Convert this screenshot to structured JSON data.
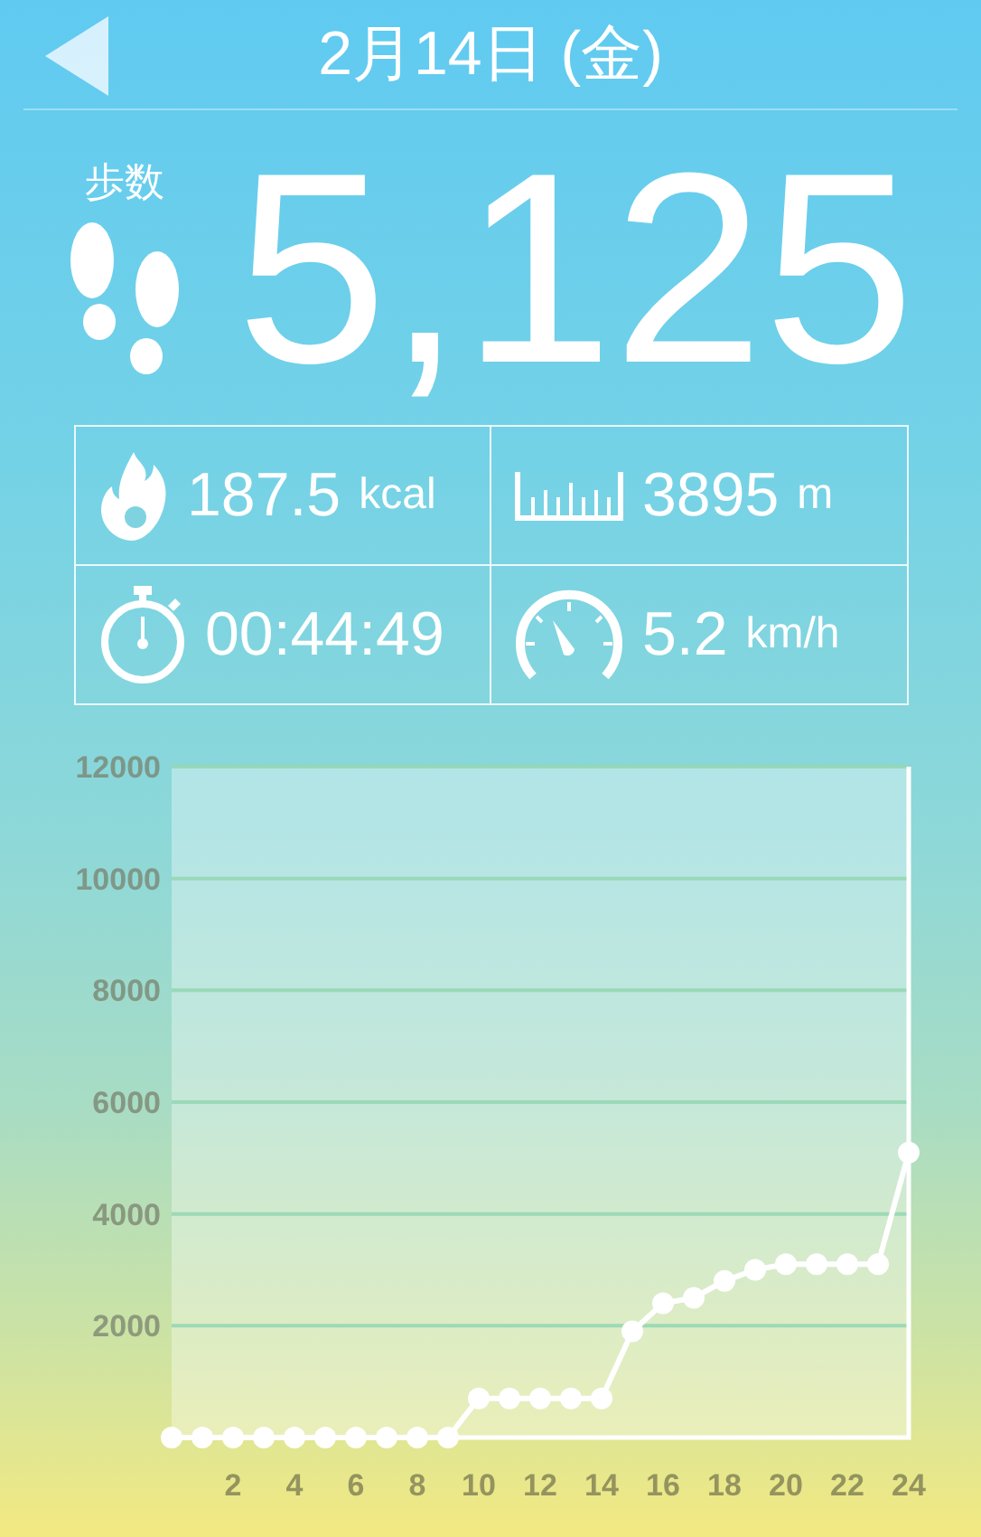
{
  "header": {
    "title": "2月14日 (金)"
  },
  "steps": {
    "label": "歩数",
    "value": "5,125"
  },
  "stats": [
    {
      "kind": "calories",
      "value": "187.5",
      "unit": "kcal"
    },
    {
      "kind": "distance",
      "value": "3895",
      "unit": "m"
    },
    {
      "kind": "time",
      "value": "00:44:49"
    },
    {
      "kind": "speed",
      "value": "5.2",
      "unit": "km/h"
    }
  ],
  "chart_data": {
    "type": "line",
    "grid": true,
    "x": [
      0,
      1,
      2,
      3,
      4,
      5,
      6,
      7,
      8,
      9,
      10,
      11,
      12,
      13,
      14,
      15,
      16,
      17,
      18,
      19,
      20,
      21,
      22,
      23,
      24
    ],
    "series": [
      {
        "color": "#ffffff",
        "marker": true,
        "values": [
          0,
          0,
          0,
          0,
          0,
          0,
          0,
          0,
          0,
          0,
          700,
          700,
          700,
          700,
          700,
          1900,
          2400,
          2500,
          2800,
          3000,
          3100,
          3100,
          3100,
          3100,
          5100
        ]
      }
    ],
    "xlim": [
      0,
      24
    ],
    "ylim": [
      0,
      12000
    ],
    "xticks": [
      2,
      4,
      6,
      8,
      10,
      12,
      14,
      16,
      18,
      20,
      22,
      24
    ],
    "yticks": [
      2000,
      4000,
      6000,
      8000,
      10000,
      12000
    ]
  }
}
